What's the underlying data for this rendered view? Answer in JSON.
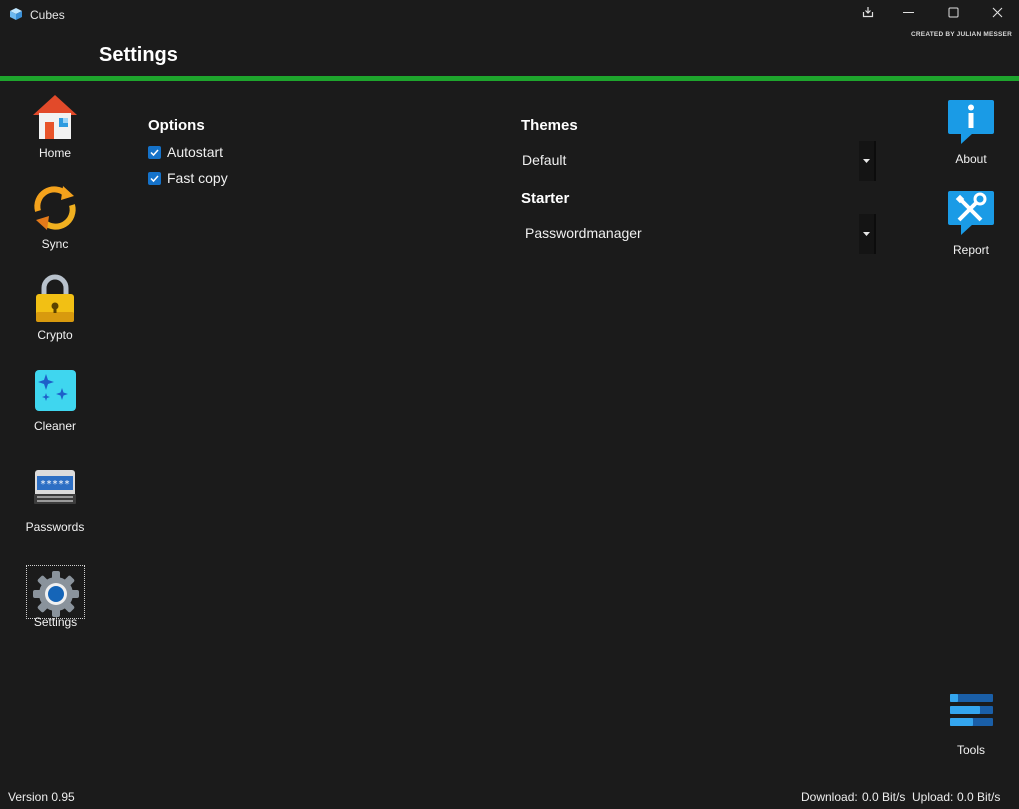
{
  "window": {
    "title": "Cubes",
    "credit": "CREATED BY JULIAN MESSER"
  },
  "page": {
    "title": "Settings"
  },
  "colors": {
    "accent": "#1ea52d",
    "background": "#1b1b1b",
    "checkbox": "#1572c9"
  },
  "sidebar": {
    "items": [
      {
        "label": "Home",
        "icon": "home-icon"
      },
      {
        "label": "Sync",
        "icon": "sync-icon"
      },
      {
        "label": "Crypto",
        "icon": "lock-icon"
      },
      {
        "label": "Cleaner",
        "icon": "sparkle-icon"
      },
      {
        "label": "Passwords",
        "icon": "password-keyboard-icon"
      },
      {
        "label": "Settings",
        "icon": "gear-icon",
        "selected": true
      }
    ]
  },
  "right_nav": {
    "items": [
      {
        "label": "About",
        "icon": "info-icon"
      },
      {
        "label": "Report",
        "icon": "tools-icon"
      },
      {
        "label": "Tools",
        "icon": "bars-icon"
      }
    ]
  },
  "options": {
    "title": "Options",
    "checkboxes": [
      {
        "label": "Autostart",
        "checked": true
      },
      {
        "label": "Fast copy",
        "checked": true
      }
    ]
  },
  "themes": {
    "title": "Themes",
    "selected": "Default"
  },
  "starter": {
    "title": "Starter",
    "selected": "Passwordmanager"
  },
  "status": {
    "version": "Version 0.95",
    "download_label": "Download:",
    "download_value": "0.0 Bit/s",
    "upload_label": "Upload:",
    "upload_value": "0.0 Bit/s"
  }
}
